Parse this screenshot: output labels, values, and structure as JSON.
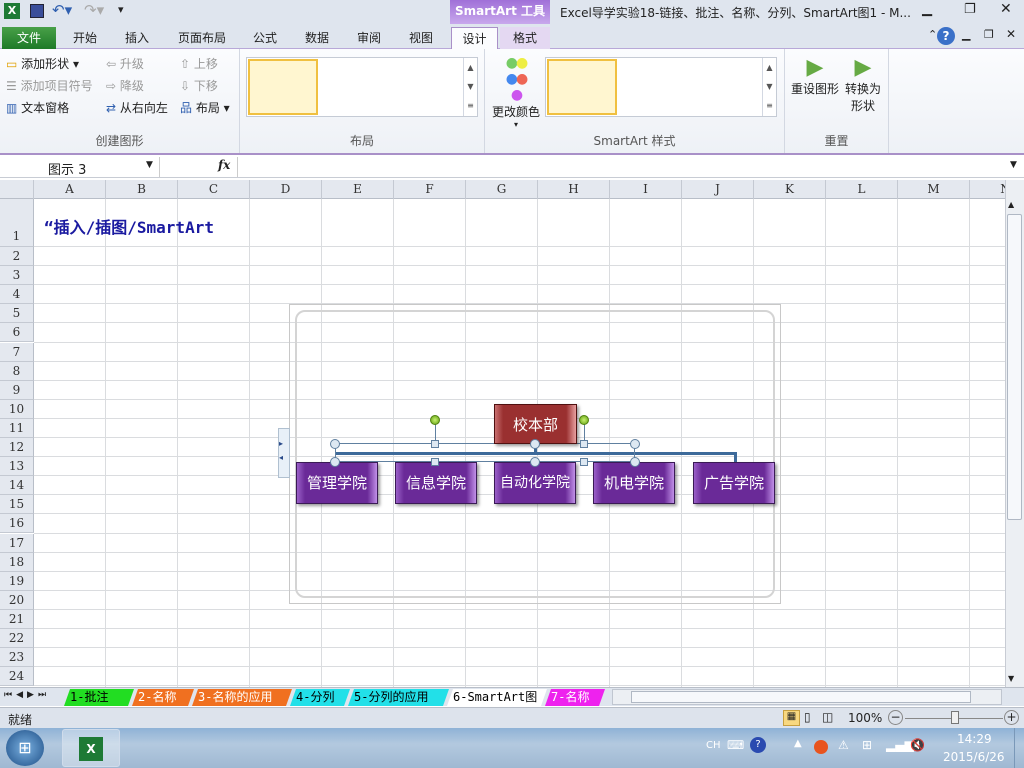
{
  "window": {
    "title": "Excel导学实验18-链接、批注、名称、分列、SmartArt图1 - M...",
    "contextual_tab": "SmartArt 工具"
  },
  "tabs": [
    {
      "label": "文件"
    },
    {
      "label": "开始"
    },
    {
      "label": "插入"
    },
    {
      "label": "页面布局"
    },
    {
      "label": "公式"
    },
    {
      "label": "数据"
    },
    {
      "label": "审阅"
    },
    {
      "label": "视图"
    },
    {
      "label": "设计"
    },
    {
      "label": "格式"
    }
  ],
  "ribbon": {
    "create": {
      "label": "创建图形",
      "add_shape": "添加形状",
      "add_bullet": "添加项目符号",
      "text_pane": "文本窗格",
      "promote": "升级",
      "demote": "降级",
      "rtl": "从右向左",
      "move_up": "上移",
      "move_down": "下移",
      "layout": "布局"
    },
    "layouts": {
      "label": "布局"
    },
    "change_colors": "更改颜色",
    "styles": {
      "label": "SmartArt 样式"
    },
    "reset": {
      "label": "重置",
      "reset_graphic": "重设图形",
      "convert": "转换为",
      "convert2": "形状"
    }
  },
  "formula_bar": {
    "name_box": "图示 3",
    "fx": "fx",
    "value": ""
  },
  "columns": [
    "A",
    "B",
    "C",
    "D",
    "E",
    "F",
    "G",
    "H",
    "I",
    "J",
    "K",
    "L",
    "M",
    "N"
  ],
  "rows": [
    "1",
    "2",
    "3",
    "4",
    "5",
    "6",
    "7",
    "8",
    "9",
    "10",
    "11",
    "12",
    "13",
    "14",
    "15",
    "16",
    "17",
    "18",
    "19",
    "20",
    "21",
    "22",
    "23",
    "24"
  ],
  "cell_a1": "“插入/插图/SmartArt",
  "smartart": {
    "root": "校本部",
    "children": [
      "管理学院",
      "信息学院",
      "自动化学院",
      "机电学院",
      "广告学院"
    ],
    "root_color": "#9a3030",
    "child_color": "#6a2a98"
  },
  "sheets": [
    {
      "label": "1-批注",
      "color": "#22dd22"
    },
    {
      "label": "2-名称",
      "color": "#f07020"
    },
    {
      "label": "3-名称的应用",
      "color": "#f07020"
    },
    {
      "label": "4-分列",
      "color": "#22e0e8"
    },
    {
      "label": "5-分列的应用",
      "color": "#22e0e8"
    },
    {
      "label": "6-SmartArt图",
      "color": "#ffffff",
      "active": true
    },
    {
      "label": "7-名称",
      "color": "#ee22ee"
    }
  ],
  "status": {
    "ready": "就绪",
    "zoom": "100%",
    "zoom_level_percent": 100
  },
  "taskbar": {
    "lang": "CH",
    "time": "14:29",
    "date": "2015/6/26"
  }
}
